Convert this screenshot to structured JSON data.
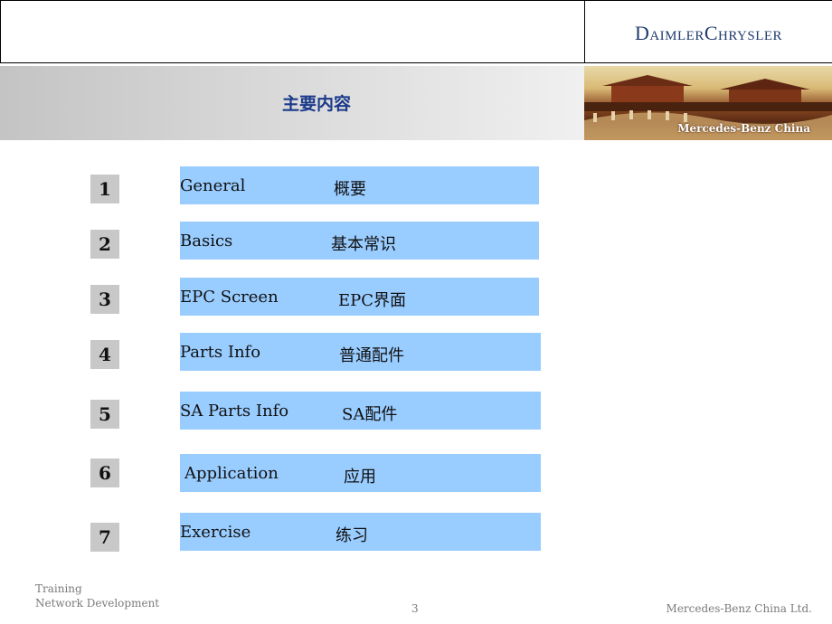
{
  "header": {
    "logo_text": "DaimlerChrysler",
    "photo_caption": "Mercedes-Benz China"
  },
  "title": "主要内容",
  "items": [
    {
      "num": "1",
      "en": "General",
      "zh": "概要"
    },
    {
      "num": "2",
      "en": "Basics",
      "zh": "基本常识"
    },
    {
      "num": "3",
      "en": "EPC Screen",
      "zh": "EPC界面"
    },
    {
      "num": "4",
      "en": "Parts Info",
      "zh": "普通配件"
    },
    {
      "num": "5",
      "en": "SA Parts Info",
      "zh": "SA配件"
    },
    {
      "num": "6",
      "en": "Application",
      "zh": "应用"
    },
    {
      "num": "7",
      "en": "Exercise",
      "zh": "练习"
    }
  ],
  "footer": {
    "line1": "Training",
    "line2": "Network Development",
    "page_number": "3",
    "company": "Mercedes-Benz China Ltd."
  },
  "colors": {
    "item_bar": "#99ccff",
    "number_box": "#c8c8c8",
    "title": "#1b3a8a",
    "logo": "#1f3a6e"
  }
}
